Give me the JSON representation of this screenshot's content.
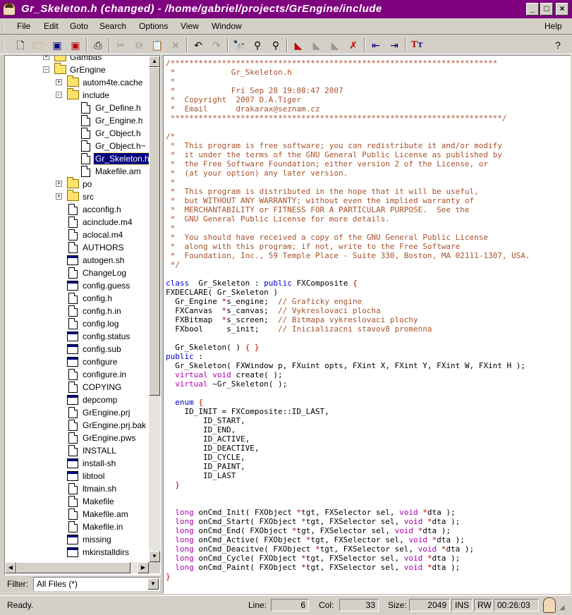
{
  "window": {
    "title": "Gr_Skeleton.h (changed) - /home/gabriel/projects/GrEngine/include",
    "controls": {
      "minimize": "_",
      "maximize": "□",
      "close": "×"
    }
  },
  "menu": {
    "file": "File",
    "edit": "Edit",
    "goto": "Goto",
    "search": "Search",
    "options": "Options",
    "view": "View",
    "window": "Window",
    "help": "Help"
  },
  "toolbar": {
    "icons": [
      "new-icon",
      "open-icon",
      "save-icon",
      "save-all-icon",
      "print-icon",
      "cut-icon",
      "copy-icon",
      "paste-icon",
      "delete-icon",
      "undo-icon",
      "redo-icon",
      "find-icon",
      "find-next-icon",
      "find-prev-icon",
      "bookmark-set-icon",
      "bookmark-next-icon",
      "bookmark-prev-icon",
      "bookmark-clear-icon",
      "shift-left-icon",
      "shift-right-icon",
      "font-icon",
      "help-icon"
    ]
  },
  "tree": {
    "items": [
      {
        "label": "Gambas",
        "type": "folder",
        "level": 1,
        "expander": "+"
      },
      {
        "label": "GrEngine",
        "type": "folder",
        "level": 1,
        "expander": "−"
      },
      {
        "label": "autom4te.cache",
        "type": "folder",
        "level": 2,
        "expander": "+"
      },
      {
        "label": "include",
        "type": "folder",
        "level": 2,
        "expander": "−"
      },
      {
        "label": "Gr_Define.h",
        "type": "file",
        "level": 3
      },
      {
        "label": "Gr_Engine.h",
        "type": "file",
        "level": 3
      },
      {
        "label": "Gr_Object.h",
        "type": "file",
        "level": 3
      },
      {
        "label": "Gr_Object.h~",
        "type": "file",
        "level": 3
      },
      {
        "label": "Gr_Skeleton.h",
        "type": "file",
        "level": 3,
        "selected": true
      },
      {
        "label": "Makefile.am",
        "type": "file",
        "level": 3
      },
      {
        "label": "po",
        "type": "folder",
        "level": 2,
        "expander": "+"
      },
      {
        "label": "src",
        "type": "folder",
        "level": 2,
        "expander": "+"
      },
      {
        "label": "acconfig.h",
        "type": "file",
        "level": 2
      },
      {
        "label": "acinclude.m4",
        "type": "file",
        "level": 2
      },
      {
        "label": "aclocal.m4",
        "type": "file",
        "level": 2
      },
      {
        "label": "AUTHORS",
        "type": "file",
        "level": 2
      },
      {
        "label": "autogen.sh",
        "type": "exec",
        "level": 2
      },
      {
        "label": "ChangeLog",
        "type": "file",
        "level": 2
      },
      {
        "label": "config.guess",
        "type": "exec",
        "level": 2
      },
      {
        "label": "config.h",
        "type": "file",
        "level": 2
      },
      {
        "label": "config.h.in",
        "type": "file",
        "level": 2
      },
      {
        "label": "config.log",
        "type": "file",
        "level": 2
      },
      {
        "label": "config.status",
        "type": "exec",
        "level": 2
      },
      {
        "label": "config.sub",
        "type": "exec",
        "level": 2
      },
      {
        "label": "configure",
        "type": "exec",
        "level": 2
      },
      {
        "label": "configure.in",
        "type": "file",
        "level": 2
      },
      {
        "label": "COPYING",
        "type": "file",
        "level": 2
      },
      {
        "label": "depcomp",
        "type": "exec",
        "level": 2
      },
      {
        "label": "GrEngine.prj",
        "type": "file",
        "level": 2
      },
      {
        "label": "GrEngine.prj.bak",
        "type": "file",
        "level": 2
      },
      {
        "label": "GrEngine.pws",
        "type": "file",
        "level": 2
      },
      {
        "label": "INSTALL",
        "type": "file",
        "level": 2
      },
      {
        "label": "install-sh",
        "type": "exec",
        "level": 2
      },
      {
        "label": "libtool",
        "type": "exec",
        "level": 2
      },
      {
        "label": "ltmain.sh",
        "type": "file",
        "level": 2
      },
      {
        "label": "Makefile",
        "type": "file",
        "level": 2
      },
      {
        "label": "Makefile.am",
        "type": "file",
        "level": 2
      },
      {
        "label": "Makefile.in",
        "type": "file",
        "level": 2
      },
      {
        "label": "missing",
        "type": "exec",
        "level": 2
      },
      {
        "label": "mkinstalldirs",
        "type": "exec",
        "level": 2
      }
    ]
  },
  "filter": {
    "label": "Filter:",
    "value": "All Files (*)"
  },
  "editor": {
    "lines": [
      [
        [
          "c",
          "/**********************************************************************"
        ]
      ],
      [
        [
          "c",
          " *            Gr_Skeleton.h"
        ]
      ],
      [
        [
          "c",
          " *"
        ]
      ],
      [
        [
          "c",
          " *            Fri Sep 28 19:08:47 2007"
        ]
      ],
      [
        [
          "c",
          " *  Copyright  2007 D.A.Tiger"
        ]
      ],
      [
        [
          "c",
          " *  Email      drakarax@seznam.cz"
        ]
      ],
      [
        [
          "c",
          " ***********************************************************************/"
        ]
      ],
      [],
      [
        [
          "c",
          "/*"
        ]
      ],
      [
        [
          "c",
          " *  This program is free software; you can redistribute it and/or modify"
        ]
      ],
      [
        [
          "c",
          " *  it under the terms of the GNU General Public License as published by"
        ]
      ],
      [
        [
          "c",
          " *  the Free Software Foundation; either version 2 of the License, or"
        ]
      ],
      [
        [
          "c",
          " *  (at your option) any later version."
        ]
      ],
      [
        [
          "c",
          " *"
        ]
      ],
      [
        [
          "c",
          " *  This program is distributed in the hope that it will be useful,"
        ]
      ],
      [
        [
          "c",
          " *  but WITHOUT ANY WARRANTY; without even the implied warranty of"
        ]
      ],
      [
        [
          "c",
          " *  MERCHANTABILITY or FITNESS FOR A PARTICULAR PURPOSE.  See the"
        ]
      ],
      [
        [
          "c",
          " *  GNU General Public License for more details."
        ]
      ],
      [
        [
          "c",
          " *"
        ]
      ],
      [
        [
          "c",
          " *  You should have received a copy of the GNU General Public License"
        ]
      ],
      [
        [
          "c",
          " *  along with this program; if not, write to the Free Software"
        ]
      ],
      [
        [
          "c",
          " *  Foundation, Inc., 59 Temple Place - Suite 330, Boston, MA 02111-1307, USA."
        ]
      ],
      [
        [
          "c",
          " */"
        ]
      ],
      [],
      [
        [
          "k",
          "class"
        ],
        [
          "",
          "  Gr_Skeleton : "
        ],
        [
          "k",
          "public"
        ],
        [
          "",
          " FXComposite "
        ],
        [
          "s",
          "{"
        ]
      ],
      [
        [
          "",
          "FXDECLARE( Gr_Skeleton )"
        ]
      ],
      [
        [
          "",
          "  Gr_Engine "
        ],
        [
          "s",
          "*"
        ],
        [
          "",
          "s_engine;  "
        ],
        [
          "c",
          "// Graficky engine"
        ]
      ],
      [
        [
          "",
          "  FXCanvas  "
        ],
        [
          "s",
          "*"
        ],
        [
          "",
          "s_canvas;  "
        ],
        [
          "c",
          "// Vykreslovaci plocha"
        ]
      ],
      [
        [
          "",
          "  FXBitmap  "
        ],
        [
          "s",
          "*"
        ],
        [
          "",
          "s_screen;  "
        ],
        [
          "c",
          "// Bitmapa vykreslovaci plochy"
        ]
      ],
      [
        [
          "",
          "  FXbool     s_init;    "
        ],
        [
          "c",
          "// Inicializacni stavov8 promenna"
        ]
      ],
      [],
      [
        [
          "",
          "  Gr_Skeleton( ) "
        ],
        [
          "s",
          "{ }"
        ]
      ],
      [
        [
          "k",
          "public"
        ],
        [
          "",
          " :"
        ]
      ],
      [
        [
          "",
          "  Gr_Skeleton( FXWindow p, FXuint opts, FXint X, FXint Y, FXint W, FXint H );"
        ]
      ],
      [
        [
          "",
          "  "
        ],
        [
          "t",
          "virtual"
        ],
        [
          "",
          " "
        ],
        [
          "t",
          "void"
        ],
        [
          "",
          " create( );"
        ]
      ],
      [
        [
          "",
          "  "
        ],
        [
          "t",
          "virtual"
        ],
        [
          "",
          " ~Gr_Skeleton( );"
        ]
      ],
      [],
      [
        [
          "",
          "  "
        ],
        [
          "k",
          "enum"
        ],
        [
          "",
          " "
        ],
        [
          "s",
          "{"
        ]
      ],
      [
        [
          "",
          "    ID_INIT = FXComposite::ID_LAST,"
        ]
      ],
      [
        [
          "",
          "        ID_START,"
        ]
      ],
      [
        [
          "",
          "        ID_END,"
        ]
      ],
      [
        [
          "",
          "        ID_ACTIVE,"
        ]
      ],
      [
        [
          "",
          "        ID_DEACTIVE,"
        ]
      ],
      [
        [
          "",
          "        ID_CYCLE,"
        ]
      ],
      [
        [
          "",
          "        ID_PAINT,"
        ]
      ],
      [
        [
          "",
          "        ID_LAST"
        ]
      ],
      [
        [
          "",
          "  "
        ],
        [
          "s",
          "}"
        ],
        [
          ";"
        ]
      ],
      [],
      [],
      [
        [
          "",
          "  "
        ],
        [
          "t",
          "long"
        ],
        [
          "",
          " onCmd_Init( FXObject "
        ],
        [
          "s",
          "*"
        ],
        [
          "",
          "tgt, FXSelector sel, "
        ],
        [
          "t",
          "void"
        ],
        [
          "",
          " "
        ],
        [
          "s",
          "*"
        ],
        [
          "",
          "dta );"
        ]
      ],
      [
        [
          "",
          "  "
        ],
        [
          "t",
          "long"
        ],
        [
          "",
          " onCmd_Start( FXObject "
        ],
        [
          "s",
          "*"
        ],
        [
          "",
          "tgt, FXSelector sel, "
        ],
        [
          "t",
          "void"
        ],
        [
          "",
          " "
        ],
        [
          "s",
          "*"
        ],
        [
          "",
          "dta );"
        ]
      ],
      [
        [
          "",
          "  "
        ],
        [
          "t",
          "long"
        ],
        [
          "",
          " onCmd_End( FXObject "
        ],
        [
          "s",
          "*"
        ],
        [
          "",
          "tgt, FXSelector sel, "
        ],
        [
          "t",
          "void"
        ],
        [
          "",
          " "
        ],
        [
          "s",
          "*"
        ],
        [
          "",
          "dta );"
        ]
      ],
      [
        [
          "",
          "  "
        ],
        [
          "t",
          "long"
        ],
        [
          "",
          " onCmd_Active( FXObject "
        ],
        [
          "s",
          "*"
        ],
        [
          "",
          "tgt, FXSelector sel, "
        ],
        [
          "t",
          "void"
        ],
        [
          "",
          " "
        ],
        [
          "s",
          "*"
        ],
        [
          "",
          "dta );"
        ]
      ],
      [
        [
          "",
          "  "
        ],
        [
          "t",
          "long"
        ],
        [
          "",
          " onCmd_Deacitve( FXObject "
        ],
        [
          "s",
          "*"
        ],
        [
          "",
          "tgt, FXSelector sel, "
        ],
        [
          "t",
          "void"
        ],
        [
          "",
          " "
        ],
        [
          "s",
          "*"
        ],
        [
          "",
          "dta );"
        ]
      ],
      [
        [
          "",
          "  "
        ],
        [
          "t",
          "long"
        ],
        [
          "",
          " onCmd_Cycle( FXObject "
        ],
        [
          "s",
          "*"
        ],
        [
          "",
          "tgt, FXSelector sel, "
        ],
        [
          "t",
          "void"
        ],
        [
          "",
          " "
        ],
        [
          "s",
          "*"
        ],
        [
          "",
          "dta );"
        ]
      ],
      [
        [
          "",
          "  "
        ],
        [
          "t",
          "long"
        ],
        [
          "",
          " onCmd_Paint( FXObject "
        ],
        [
          "s",
          "*"
        ],
        [
          "",
          "tgt, FXSelector sel, "
        ],
        [
          "t",
          "void"
        ],
        [
          "",
          " "
        ],
        [
          "s",
          "*"
        ],
        [
          "",
          "dta );"
        ]
      ],
      [
        [
          "s",
          "}"
        ],
        [
          ";"
        ]
      ]
    ]
  },
  "status": {
    "message": "Ready.",
    "line_label": "Line:",
    "line": "6",
    "col_label": "Col:",
    "col": "33",
    "size_label": "Size:",
    "size": "2049",
    "ins": "INS",
    "rw": "RW",
    "time": "00:26:03"
  },
  "colors": {
    "titlebar": "#7f007f",
    "comment": "#a8522d",
    "keyword": "#0000cc",
    "type": "#b000b0",
    "symbol": "#c00000",
    "selection": "#000080"
  }
}
